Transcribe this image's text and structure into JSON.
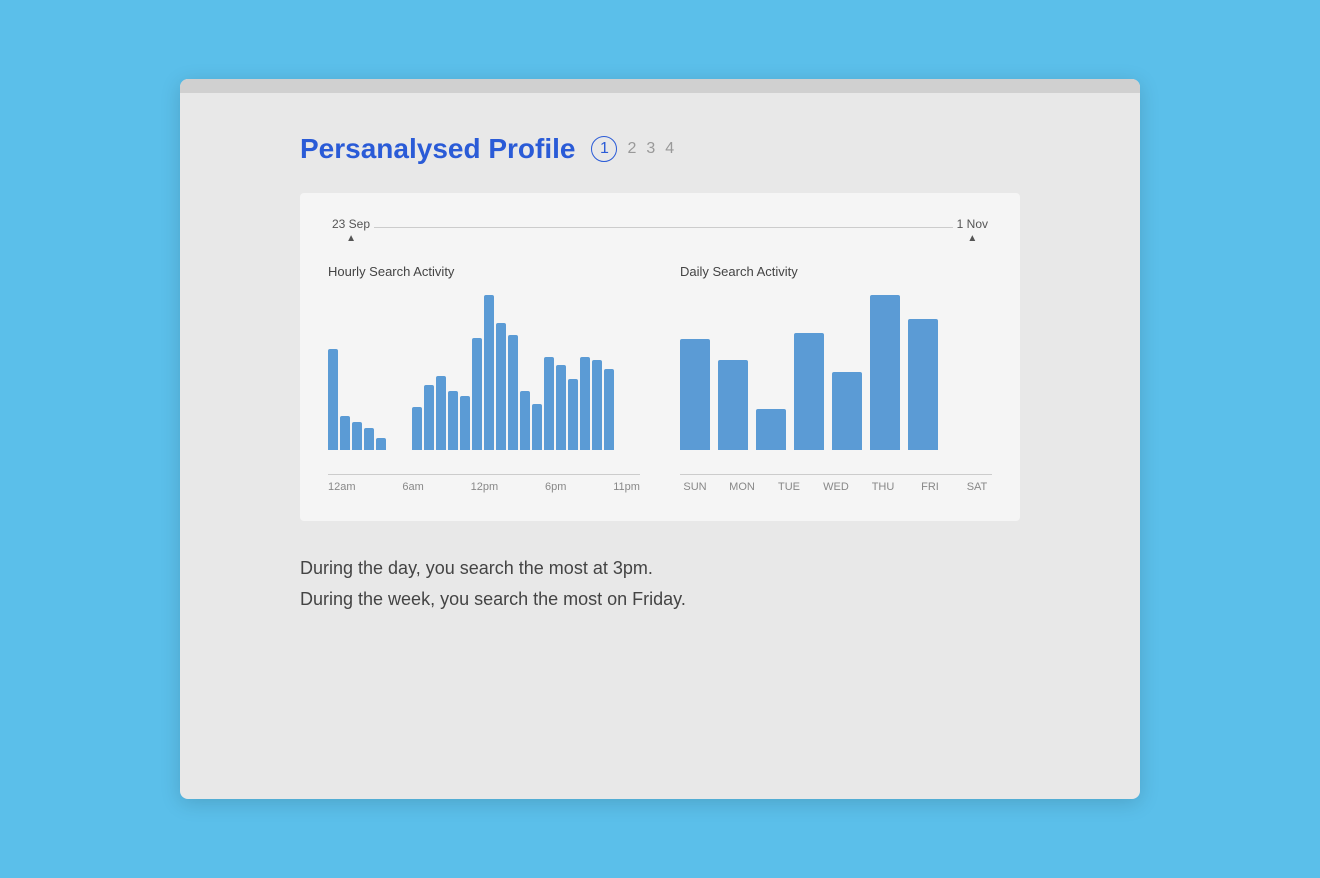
{
  "header": {
    "title": "Persanalysed Profile",
    "pagination": {
      "active": "1",
      "pages": [
        "1",
        "2",
        "3",
        "4"
      ]
    }
  },
  "date_range": {
    "start": "23 Sep",
    "end": "1 Nov"
  },
  "hourly_chart": {
    "title": "Hourly Search Activity",
    "bars": [
      65,
      22,
      18,
      14,
      8,
      0,
      0,
      28,
      42,
      48,
      38,
      35,
      72,
      100,
      82,
      74,
      38,
      30,
      60,
      55,
      46,
      60,
      58,
      52
    ],
    "x_labels": [
      "12am",
      "6am",
      "12pm",
      "6pm",
      "11pm"
    ]
  },
  "daily_chart": {
    "title": "Daily Search Activity",
    "bars": [
      68,
      55,
      25,
      72,
      48,
      95,
      80
    ],
    "x_labels": [
      "SUN",
      "MON",
      "TUE",
      "WED",
      "THU",
      "FRI",
      "SAT"
    ]
  },
  "summary": {
    "line1": "During the day, you search the most at 3pm.",
    "line2": "During the week, you search the most on Friday."
  }
}
